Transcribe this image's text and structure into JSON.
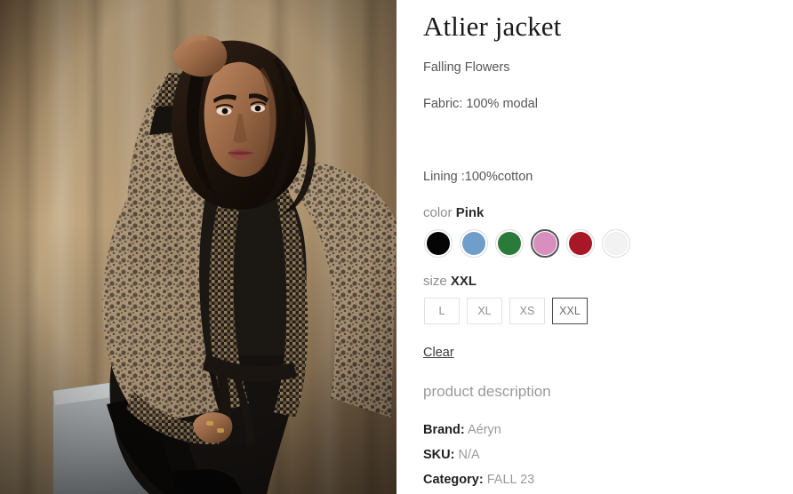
{
  "product": {
    "title": "Atlier jacket",
    "subtitle": "Falling Flowers",
    "fabric": "Fabric: 100% modal",
    "lining": "Lining :100%cotton"
  },
  "color_picker": {
    "label": "color",
    "selected": "Pink",
    "swatches": [
      {
        "name": "Black",
        "hex": "#050505",
        "selected": false,
        "light": false
      },
      {
        "name": "Blue",
        "hex": "#6f9ecb",
        "selected": false,
        "light": false
      },
      {
        "name": "Green",
        "hex": "#2a7b39",
        "selected": false,
        "light": false
      },
      {
        "name": "Pink",
        "hex": "#d88fbd",
        "selected": true,
        "light": false
      },
      {
        "name": "Red",
        "hex": "#a81726",
        "selected": false,
        "light": false
      },
      {
        "name": "White",
        "hex": "#f2f2f2",
        "selected": false,
        "light": true
      }
    ]
  },
  "size_picker": {
    "label": "size",
    "selected": "XXL",
    "options": [
      {
        "label": "L",
        "selected": false
      },
      {
        "label": "XL",
        "selected": false
      },
      {
        "label": "XS",
        "selected": false
      },
      {
        "label": "XXL",
        "selected": true
      }
    ]
  },
  "clear_label": "Clear",
  "description": {
    "heading": "product description"
  },
  "meta": {
    "brand_key": "Brand:",
    "brand_value": "Aéryn",
    "sku_key": "SKU:",
    "sku_value": "N/A",
    "category_key": "Category:",
    "category_value": "FALL 23"
  },
  "gallery": {
    "alt": "Model wearing the Atlier jacket in front of a draped beige backdrop",
    "backdrop_color": "#c8ad86",
    "jacket_color": "#b09a82",
    "accent_color": "#2b2219"
  }
}
